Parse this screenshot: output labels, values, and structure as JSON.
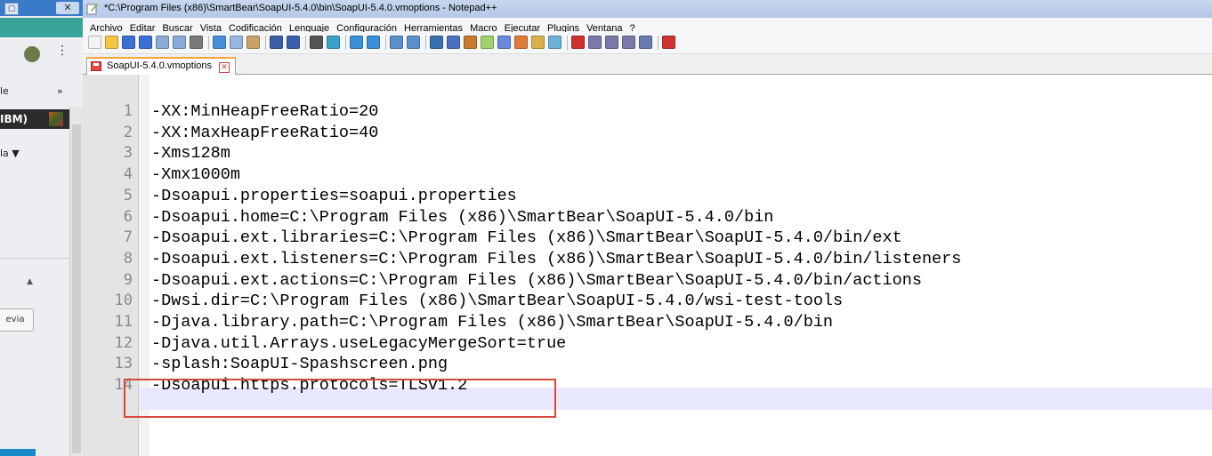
{
  "background_window": {
    "frag_le": "le",
    "frag_chev": "»",
    "frag_ibm": "IBM)",
    "frag_la": "la ▼",
    "frag_up": "▲",
    "frag_button": "evia"
  },
  "window": {
    "title": "*C:\\Program Files (x86)\\SmartBear\\SoapUI-5.4.0\\bin\\SoapUI-5.4.0.vmoptions - Notepad++"
  },
  "menu": [
    "Archivo",
    "Editar",
    "Buscar",
    "Vista",
    "Codificación",
    "Lenguaje",
    "Configuración",
    "Herramientas",
    "Macro",
    "Ejecutar",
    "Plugins",
    "Ventana",
    "?"
  ],
  "tab": {
    "label": "SoapUI-5.4.0.vmoptions"
  },
  "editor": {
    "lines": [
      {
        "n": "1",
        "text": "-XX:MinHeapFreeRatio=20"
      },
      {
        "n": "2",
        "text": "-XX:MaxHeapFreeRatio=40"
      },
      {
        "n": "3",
        "text": "-Xms128m"
      },
      {
        "n": "4",
        "text": "-Xmx1000m"
      },
      {
        "n": "5",
        "text": "-Dsoapui.properties=soapui.properties"
      },
      {
        "n": "6",
        "text": "-Dsoapui.home=C:\\Program Files (x86)\\SmartBear\\SoapUI-5.4.0/bin"
      },
      {
        "n": "7",
        "text": "-Dsoapui.ext.libraries=C:\\Program Files (x86)\\SmartBear\\SoapUI-5.4.0/bin/ext"
      },
      {
        "n": "8",
        "text": "-Dsoapui.ext.listeners=C:\\Program Files (x86)\\SmartBear\\SoapUI-5.4.0/bin/listeners"
      },
      {
        "n": "9",
        "text": "-Dsoapui.ext.actions=C:\\Program Files (x86)\\SmartBear\\SoapUI-5.4.0/bin/actions"
      },
      {
        "n": "10",
        "text": "-Dwsi.dir=C:\\Program Files (x86)\\SmartBear\\SoapUI-5.4.0/wsi-test-tools"
      },
      {
        "n": "11",
        "text": "-Djava.library.path=C:\\Program Files (x86)\\SmartBear\\SoapUI-5.4.0/bin"
      },
      {
        "n": "12",
        "text": "-Djava.util.Arrays.useLegacyMergeSort=true"
      },
      {
        "n": "13",
        "text": "-splash:SoapUI-Spashscreen.png"
      },
      {
        "n": "14",
        "text": "-Dsoapui.https.protocols=TLSv1.2"
      }
    ]
  },
  "colors": {
    "highlight_box": "#d9463b",
    "current_line": "#e8e8ff",
    "tab_accent": "#f7a33a"
  }
}
